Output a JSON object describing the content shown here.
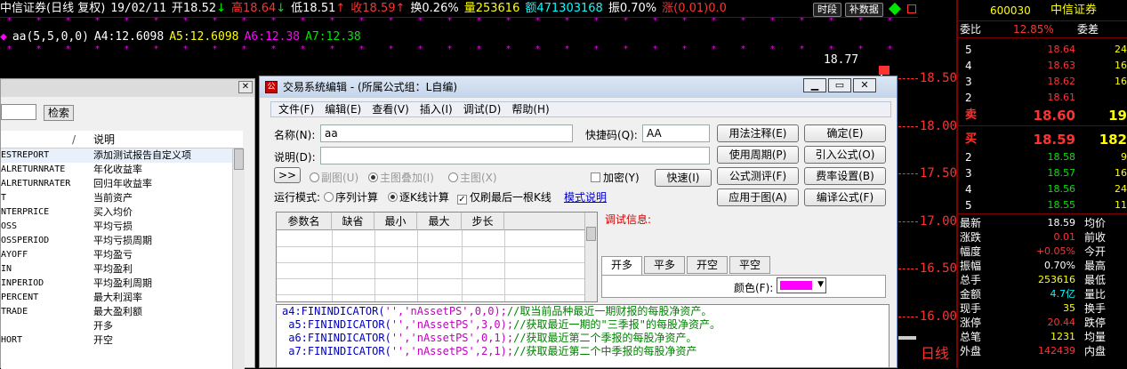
{
  "topbar": {
    "title": "中信证券(日线 复权)",
    "date": "19/02/11",
    "open": "开18.52",
    "open_arrow": "↓",
    "high": "高18.64",
    "high_arrow": "↓",
    "low": "低18.51",
    "low_arrow": "↑",
    "close": "收18.59",
    "close_arrow": "↑",
    "turnover": "换0.26%",
    "volume": "量253616",
    "amount": "额471303168",
    "amplitude": "振0.70%",
    "change": "涨(0.01)0.0",
    "btn_period": "时段",
    "btn_fill": "补数据"
  },
  "indicator_line": {
    "name": "aa(5,5,0,0)",
    "a4": "A4:12.6098",
    "a5": "A5:12.6098",
    "a6": "A6:12.38",
    "a7": "A7:12.38"
  },
  "chart_price_labels": [
    "18.77",
    "18.50",
    "18.00",
    "17.50",
    "17.00",
    "16.50",
    "16.00"
  ],
  "price_axis_values": [
    18.5,
    18.0,
    17.5,
    17.0,
    16.5,
    16.0
  ],
  "kline_label": "日线",
  "colors": {
    "up": "#ff3232",
    "down": "#00e600",
    "accent": "#ff00ff"
  },
  "quote": {
    "code": "600030",
    "name": "中信证券",
    "weibi_label": "委比",
    "weibi_value": "12.85%",
    "weicha_label": "委差",
    "sell": [
      {
        "level": "5",
        "price": "18.64",
        "vol": "24"
      },
      {
        "level": "4",
        "price": "18.63",
        "vol": "16"
      },
      {
        "level": "3",
        "price": "18.62",
        "vol": "16"
      },
      {
        "level": "2",
        "price": "18.61",
        "vol": ""
      },
      {
        "level": "卖",
        "price": "18.60",
        "vol": "19"
      }
    ],
    "buy": [
      {
        "level": "买",
        "price": "18.59",
        "vol": "182"
      },
      {
        "level": "2",
        "price": "18.58",
        "vol": "9"
      },
      {
        "level": "3",
        "price": "18.57",
        "vol": "16"
      },
      {
        "level": "4",
        "price": "18.56",
        "vol": "24"
      },
      {
        "level": "5",
        "price": "18.55",
        "vol": "11"
      }
    ],
    "stats": [
      {
        "l": "最新",
        "v": "18.59",
        "l2": "均价"
      },
      {
        "l": "涨跌",
        "v": "0.01",
        "l2": "前收"
      },
      {
        "l": "幅度",
        "v": "+0.05%",
        "l2": "今开"
      },
      {
        "l": "振幅",
        "v": "0.70%",
        "l2": "最高"
      },
      {
        "l": "总手",
        "v": "253616",
        "l2": "最低"
      },
      {
        "l": "金额",
        "v": "4.7亿",
        "l2": "量比"
      },
      {
        "l": "现手",
        "v": "35",
        "l2": "换手"
      },
      {
        "l": "涨停",
        "v": "20.44",
        "l2": "跌停"
      },
      {
        "l": "总笔",
        "v": "1231",
        "l2": "均量"
      },
      {
        "l": "外盘",
        "v": "142439",
        "l2": "内盘"
      }
    ]
  },
  "leftpanel": {
    "search_btn": "检索",
    "col1": "/",
    "col2": "说明",
    "items": [
      {
        "a": "ESTREPORT",
        "b": "添加测试报告自定义项"
      },
      {
        "a": "ALRETURNRATE",
        "b": "年化收益率"
      },
      {
        "a": "ALRETURNRATER",
        "b": "回归年收益率"
      },
      {
        "a": "T",
        "b": "当前资产"
      },
      {
        "a": "NTERPRICE",
        "b": "买入均价"
      },
      {
        "a": "OSS",
        "b": "平均亏损"
      },
      {
        "a": "OSSPERIOD",
        "b": "平均亏损周期"
      },
      {
        "a": "AYOFF",
        "b": "平均盈亏"
      },
      {
        "a": "IN",
        "b": "平均盈利"
      },
      {
        "a": "INPERIOD",
        "b": "平均盈利周期"
      },
      {
        "a": "PERCENT",
        "b": "最大利润率"
      },
      {
        "a": "TRADE",
        "b": "最大盈利额"
      },
      {
        "a": "",
        "b": "开多"
      },
      {
        "a": "HORT",
        "b": "开空"
      }
    ]
  },
  "dialog": {
    "title": "交易系统编辑 - (所属公式组：L自编)",
    "menu": [
      "文件(F)",
      "编辑(E)",
      "查看(V)",
      "插入(I)",
      "调试(D)",
      "帮助(H)"
    ],
    "name_label": "名称(N):",
    "name_value": "aa",
    "shortcut_label": "快捷码(Q):",
    "shortcut_value": "AA",
    "desc_label": "说明(D):",
    "desc_value": "",
    "expand_btn": ">>",
    "radio_sub": "副图(U)",
    "radio_main_overlay": "主图叠加(I)",
    "radio_main": "主图(X)",
    "encrypt_label": "加密(Y)",
    "run_mode_label": "运行模式:",
    "run_seq": "序列计算",
    "run_each": "逐K线计算",
    "only_last": "仅刷最后一根K线",
    "mode_desc": "模式说明",
    "buttons": {
      "usage": "用法注释(E)",
      "period": "使用周期(P)",
      "test": "公式测评(F)",
      "apply": "应用于图(A)",
      "ok": "确定(E)",
      "import": "引入公式(O)",
      "fee": "费率设置(B)",
      "compile": "编译公式(F)",
      "quick": "快速(I)"
    },
    "param_headers": [
      "参数名",
      "缺省",
      "最小",
      "最大",
      "步长"
    ],
    "debug_label": "调试信息:",
    "tabs": [
      "开多",
      "平多",
      "开空",
      "平空"
    ],
    "color_label": "颜色(F):",
    "code_lines": [
      {
        "fn": "a4:FININDICATOR(",
        "args": "'','nAssetPS',0,0);",
        "comment": "//取当前品种最近一期财报的每股净资产。"
      },
      {
        "fn": " a5:FININDICATOR(",
        "args": "'','nAssetPS',3,0);",
        "comment": "//获取最近一期的\"三季报\"的每股净资产。"
      },
      {
        "fn": " a6:FININDICATOR(",
        "args": "'','nAssetPS',0,1);",
        "comment": "//获取最近第二个季报的每股净资产。"
      },
      {
        "fn": " a7:FININDICATOR(",
        "args": "'','nAssetPS',2,1);",
        "comment": "//获取最近第二个中季报的每股净资产"
      }
    ]
  }
}
